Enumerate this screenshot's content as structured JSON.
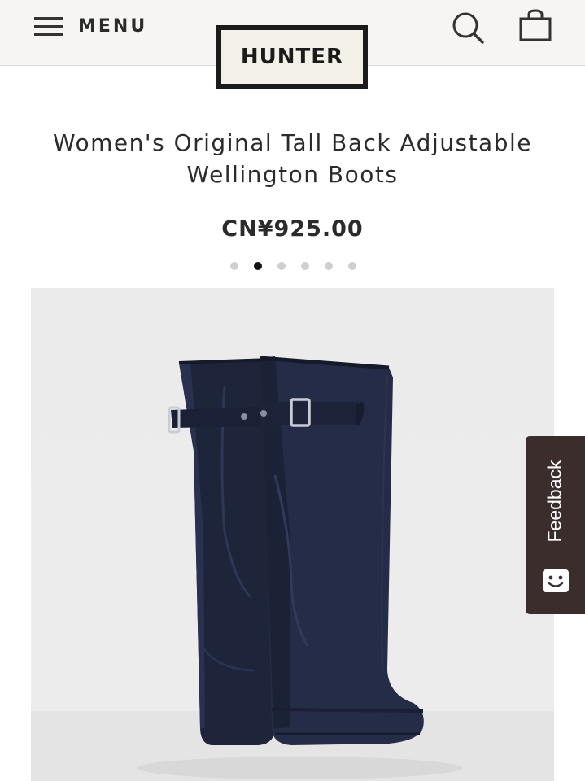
{
  "header": {
    "menu_label": "MENU",
    "brand": "HUNTER"
  },
  "product": {
    "title": "Women's Original Tall Back Adjustable Wellington Boots",
    "price": "CN¥925.00"
  },
  "carousel": {
    "total": 6,
    "active_index": 2
  },
  "feedback": {
    "label": "Feedback"
  },
  "colors": {
    "boot": "#232a42",
    "header_bg": "#f6f5f3",
    "feedback_bg": "#3a2d2b"
  },
  "icons": [
    "hamburger-icon",
    "search-icon",
    "bag-icon",
    "smiley-icon"
  ]
}
